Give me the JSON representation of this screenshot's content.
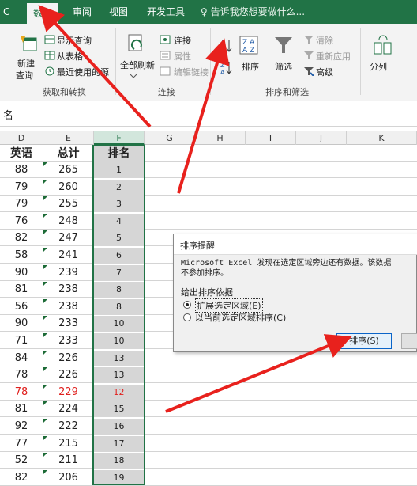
{
  "tabs": [
    {
      "label": "C",
      "active": false
    },
    {
      "label": "数据",
      "active": true
    },
    {
      "label": "审阅",
      "active": false
    },
    {
      "label": "视图",
      "active": false
    },
    {
      "label": "开发工具",
      "active": false
    }
  ],
  "tell_me": "♀ 告诉我您想要做什么...",
  "ribbon": {
    "get_transform": {
      "new_query": "新建",
      "new_query_2": "查询",
      "show_queries": "显示查询",
      "from_table": "从表格",
      "recent_sources": "最近使用的源",
      "group": "获取和转换"
    },
    "connections": {
      "refresh_all": "全部刷新",
      "connections": "连接",
      "properties": "属性",
      "edit_links": "编辑链接",
      "group": "连接"
    },
    "sort_filter": {
      "sort": "排序",
      "filter": "筛选",
      "clear": "清除",
      "reapply": "重新应用",
      "advanced": "高级",
      "group": "排序和筛选"
    },
    "split": "分列"
  },
  "name_box": "名",
  "columns": [
    "D",
    "E",
    "F",
    "G",
    "H",
    "I",
    "J",
    "K"
  ],
  "header_row": [
    "英语",
    "总计",
    "排名"
  ],
  "rows": [
    {
      "d": "88",
      "e": "265",
      "f": "1"
    },
    {
      "d": "79",
      "e": "260",
      "f": "2"
    },
    {
      "d": "79",
      "e": "255",
      "f": "3"
    },
    {
      "d": "76",
      "e": "248",
      "f": "4"
    },
    {
      "d": "82",
      "e": "247",
      "f": "5"
    },
    {
      "d": "58",
      "e": "241",
      "f": "6"
    },
    {
      "d": "90",
      "e": "239",
      "f": "7"
    },
    {
      "d": "81",
      "e": "238",
      "f": "8"
    },
    {
      "d": "56",
      "e": "238",
      "f": "8"
    },
    {
      "d": "90",
      "e": "233",
      "f": "10"
    },
    {
      "d": "71",
      "e": "233",
      "f": "10"
    },
    {
      "d": "84",
      "e": "226",
      "f": "13"
    },
    {
      "d": "78",
      "e": "226",
      "f": "13"
    },
    {
      "d": "78",
      "e": "229",
      "f": "12",
      "red": true
    },
    {
      "d": "81",
      "e": "224",
      "f": "15"
    },
    {
      "d": "92",
      "e": "222",
      "f": "16"
    },
    {
      "d": "77",
      "e": "215",
      "f": "17"
    },
    {
      "d": "52",
      "e": "211",
      "f": "18"
    },
    {
      "d": "82",
      "e": "206",
      "f": "19"
    }
  ],
  "dialog": {
    "title": "排序提醒",
    "message_1": "Microsoft Excel 发现在选定区域旁边还有数据。该数据",
    "message_2": "不参加排序。",
    "sort_basis": "给出排序依据",
    "option_expand": "扩展选定区域(E)",
    "option_current": "以当前选定区域排序(C)",
    "sort_button": "排序(S)"
  },
  "colors": {
    "excel_green": "#217346",
    "arrow_red": "#e8211d"
  }
}
